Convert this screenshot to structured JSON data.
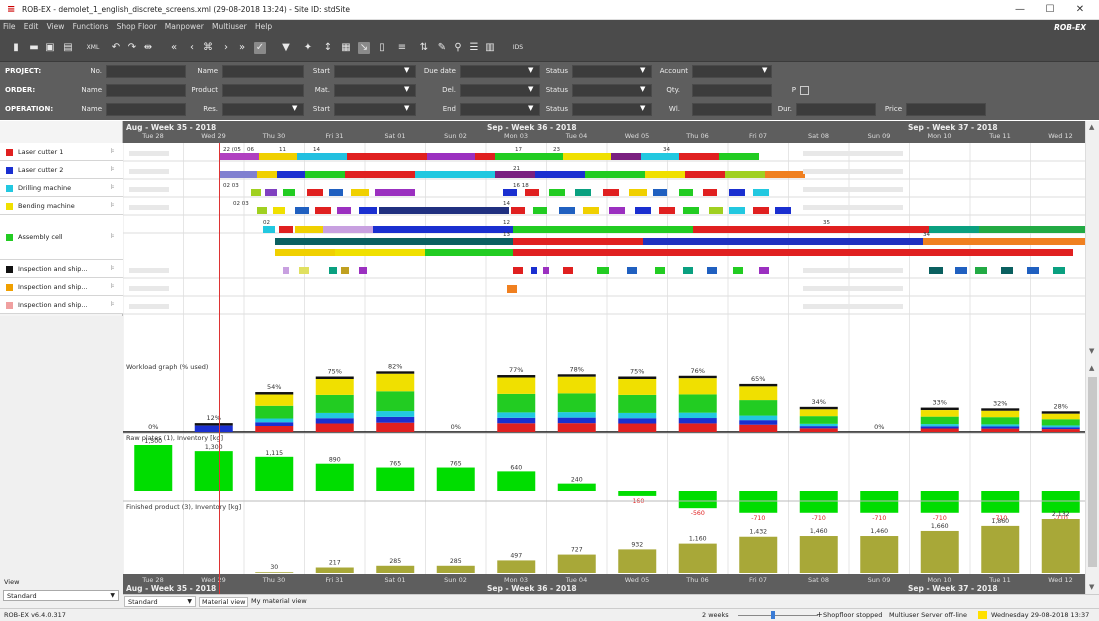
{
  "window": {
    "title": "ROB-EX - demolet_1_english_discrete_screens.xml (29-08-2018 13:24) - Site ID: stdSite",
    "minimize": "—",
    "maximize": "☐",
    "close": "✕"
  },
  "menu": [
    "File",
    "Edit",
    "View",
    "Functions",
    "Shop Floor",
    "Manpower",
    "Multiuser",
    "Help"
  ],
  "brand": "ROB-EX",
  "toolbar": {
    "ids_label": "IDS",
    "xml_label": "XML"
  },
  "filters": {
    "project": {
      "label": "PROJECT:",
      "no": "No.",
      "name": "Name",
      "start": "Start",
      "due": "Due date",
      "status": "Status",
      "account": "Account"
    },
    "order": {
      "label": "ORDER:",
      "name": "Name",
      "product": "Product",
      "mat": "Mat.",
      "del": "Del.",
      "status": "Status",
      "qty": "Qty.",
      "p": "P"
    },
    "operation": {
      "label": "OPERATION:",
      "name": "Name",
      "res": "Res.",
      "start": "Start",
      "end": "End",
      "status": "Status",
      "wl": "Wl.",
      "dur": "Dur.",
      "price": "Price"
    }
  },
  "resources": [
    {
      "name": "Laser cutter 1",
      "color": "#e02020"
    },
    {
      "name": "Laser cutter 2",
      "color": "#1a2fd0"
    },
    {
      "name": "Drilling machine",
      "color": "#22c8e0"
    },
    {
      "name": "Bending machine",
      "color": "#f0e000"
    },
    {
      "name": "Assembly cell",
      "color": "#22cc22"
    },
    {
      "name": "Inspection and ship...",
      "color": "#111111"
    },
    {
      "name": "Inspection and ship...",
      "color": "#f0a000"
    },
    {
      "name": "Inspection and ship...",
      "color": "#f0a0a0"
    }
  ],
  "timeline": {
    "weeks": [
      "Aug - Week 35 - 2018",
      "Sep - Week 36 - 2018",
      "Sep - Week 37 - 2018"
    ],
    "days": [
      "Tue 28",
      "Wed 29",
      "Thu 30",
      "Fri 31",
      "Sat 01",
      "Sun 02",
      "Mon 03",
      "Tue 04",
      "Wed 05",
      "Thu 06",
      "Fri 07",
      "Sat 08",
      "Sun 09",
      "Mon 10",
      "Tue 11",
      "Wed 12"
    ]
  },
  "chart_data": [
    {
      "type": "bar",
      "title": "Workload graph (% used)",
      "categories": [
        "Tue 28",
        "Wed 29",
        "Thu 30",
        "Fri 31",
        "Sat 01",
        "Sun 02",
        "Mon 03",
        "Tue 04",
        "Wed 05",
        "Thu 06",
        "Fri 07",
        "Sat 08",
        "Sun 09",
        "Mon 10",
        "Tue 11",
        "Wed 12"
      ],
      "values": [
        0,
        12,
        54,
        75,
        82,
        0,
        77,
        78,
        75,
        76,
        65,
        34,
        0,
        33,
        32,
        28
      ],
      "labels": [
        "0%",
        "12%",
        "54%",
        "75%",
        "82%",
        "0%",
        "77%",
        "78%",
        "75%",
        "76%",
        "65%",
        "34%",
        "0%",
        "33%",
        "32%",
        "28%"
      ]
    },
    {
      "type": "bar",
      "title": "Raw plates (1), Inventory [kg]",
      "categories": [
        "Tue 28",
        "Wed 29",
        "Thu 30",
        "Fri 31",
        "Sat 01",
        "Sun 02",
        "Mon 03",
        "Tue 04",
        "Wed 05",
        "Thu 06",
        "Fri 07",
        "Sat 08",
        "Sun 09",
        "Mon 10",
        "Tue 11",
        "Wed 12"
      ],
      "values": [
        1500,
        1300,
        1115,
        890,
        765,
        765,
        640,
        240,
        -160,
        -560,
        -710,
        -710,
        -710,
        -710,
        -710,
        -710
      ],
      "labels": [
        "1,500",
        "1,300",
        "1,115",
        "890",
        "765",
        "765",
        "640",
        "240",
        "-160",
        "-560",
        "-710",
        "-710",
        "-710",
        "-710",
        "-710",
        "-710"
      ]
    },
    {
      "type": "bar",
      "title": "Finished product (3), Inventory [kg]",
      "categories": [
        "Tue 28",
        "Wed 29",
        "Thu 30",
        "Fri 31",
        "Sat 01",
        "Sun 02",
        "Mon 03",
        "Tue 04",
        "Wed 05",
        "Thu 06",
        "Fri 07",
        "Sat 08",
        "Sun 09",
        "Mon 10",
        "Tue 11",
        "Wed 12"
      ],
      "values": [
        0,
        0,
        30,
        217,
        285,
        285,
        497,
        727,
        932,
        1160,
        1432,
        1460,
        1460,
        1660,
        1860,
        2132
      ],
      "labels": [
        "",
        "",
        "30",
        "217",
        "285",
        "285",
        "497",
        "727",
        "932",
        "1,160",
        "1,432",
        "1,460",
        "1,460",
        "1,660",
        "1,860",
        "2,132"
      ]
    }
  ],
  "view": {
    "label": "View",
    "value": "Standard"
  },
  "tabs": {
    "selector": "Standard",
    "material_view": "Material view",
    "my_material_view": "My material view"
  },
  "status": {
    "version": "ROB-EX v6.4.0.317",
    "zoom": "2 weeks",
    "shopfloor": "Shopfloor stopped",
    "multiuser": "Multiuser Server off-line",
    "date": "Wednesday 29-08-2018 13:37"
  }
}
